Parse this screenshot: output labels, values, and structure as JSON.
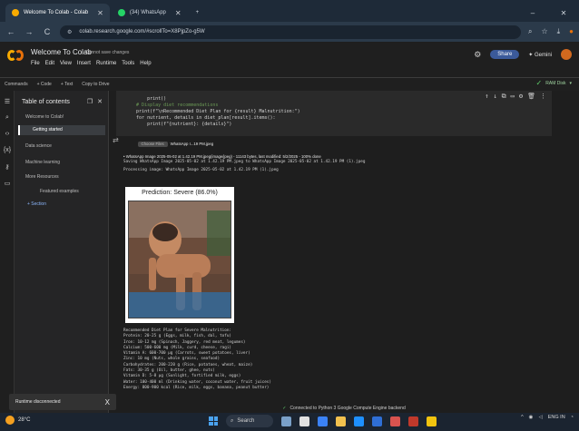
{
  "browser": {
    "tabs": [
      {
        "label": "Welcome To Colab - Colab",
        "active": true,
        "favicon_color": "#f9ab00"
      },
      {
        "label": "(34) WhatsApp",
        "active": false,
        "favicon_color": "#25d366"
      }
    ],
    "new_tab": "+",
    "window_controls": {
      "minimize": "–",
      "close": "✕"
    },
    "address": "colab.research.google.com/#scrollTo=X8PjpZo-g5W",
    "nav": {
      "back": "←",
      "forward": "→",
      "reload": "C"
    }
  },
  "colab": {
    "title": "Welcome To Colab",
    "save_status": "Cannot save changes",
    "menus": [
      "File",
      "Edit",
      "View",
      "Insert",
      "Runtime",
      "Tools",
      "Help"
    ],
    "share_label": "Share",
    "gemini_label": "Gemini",
    "toolbar": [
      "Commands",
      "+ Code",
      "+ Text",
      "Copy to Drive"
    ],
    "ram_label": "RAM Disk"
  },
  "toc": {
    "title": "Table of contents",
    "items": [
      {
        "label": "Welcome to Colab!",
        "level": 0,
        "active": false
      },
      {
        "label": "Getting started",
        "level": 0,
        "active": true
      },
      {
        "label": "Data science",
        "level": 0,
        "active": false
      },
      {
        "label": "Machine learning",
        "level": 0,
        "active": false
      },
      {
        "label": "More Resources",
        "level": 0,
        "active": false
      },
      {
        "label": "Featured examples",
        "level": 1,
        "active": false
      }
    ],
    "add_section": "+ Section"
  },
  "snackbar": {
    "text": "Runtime disconnected",
    "close": "X"
  },
  "code": {
    "lines": [
      {
        "text": "        print()",
        "kind": "code"
      },
      {
        "text": "",
        "kind": "code"
      },
      {
        "text": "    # Display diet recommendations",
        "kind": "cmt"
      },
      {
        "text": "    print(f\"\\nRecommended Diet Plan for {result} Malnutrition:\")",
        "kind": "code"
      },
      {
        "text": "    for nutrient, details in diet_plan[result].items():",
        "kind": "code"
      },
      {
        "text": "        print(f\"{nutrient}: {details}\")",
        "kind": "code"
      }
    ]
  },
  "output": {
    "choose_files": "Choose Files",
    "file_chosen": "WhatsApp I...19 PM.jpeg",
    "upload_line": "WhatsApp Image 2025-05-02 at 1.42.19 PM.jpeg(image/jpeg) - 11143 bytes, last modified: 5/2/2025 - 100% done",
    "saving_line": "Saving WhatsApp Image 2025-05-02 at 1.42.19 PM.jpeg to WhatsApp Image 2025-05-02 at 1.42.19 PM (1).jpeg",
    "processing_line": "Processing image: WhatsApp Image 2025-05-02 at 1.42.19 PM (1).jpeg",
    "prediction_title": "Prediction: Severe (86.0%)",
    "diet_header": "Recommended Diet Plan for Severe Malnutrition:",
    "diet_lines": [
      "Protein: 20-25 g (Eggs, milk, fish, dal, tofu)",
      "Iron: 10-12 mg (Spinach, Jaggery, red meat, legumes)",
      "Calcium: 500-600 mg (Milk, curd, cheese, ragi)",
      "Vitamin A: 600-700 µg (Carrots, sweet potatoes, liver)",
      "Zinc: 10 mg (Nuts, whole grains, seafood)",
      "Carbohydrates: 200-220 g (Rice, potatoes, wheat, maize)",
      "Fats: 30-35 g (Oil, butter, ghee, nuts)",
      "Vitamin D: 5-8 µg (Sunlight, fortified milk, eggs)",
      "Water: 100-400 ml (Drinking water, coconut water, fruit juices)",
      "Energy: 800-900 kcal (Rice, milk, eggs, banana, peanut butter)"
    ]
  },
  "status": {
    "text": "Connected to Python 3 Google Compute Engine backend"
  },
  "taskbar": {
    "weather": "28°C",
    "search": "Search",
    "tray_lang": "ENG",
    "tray_region": "IN"
  }
}
